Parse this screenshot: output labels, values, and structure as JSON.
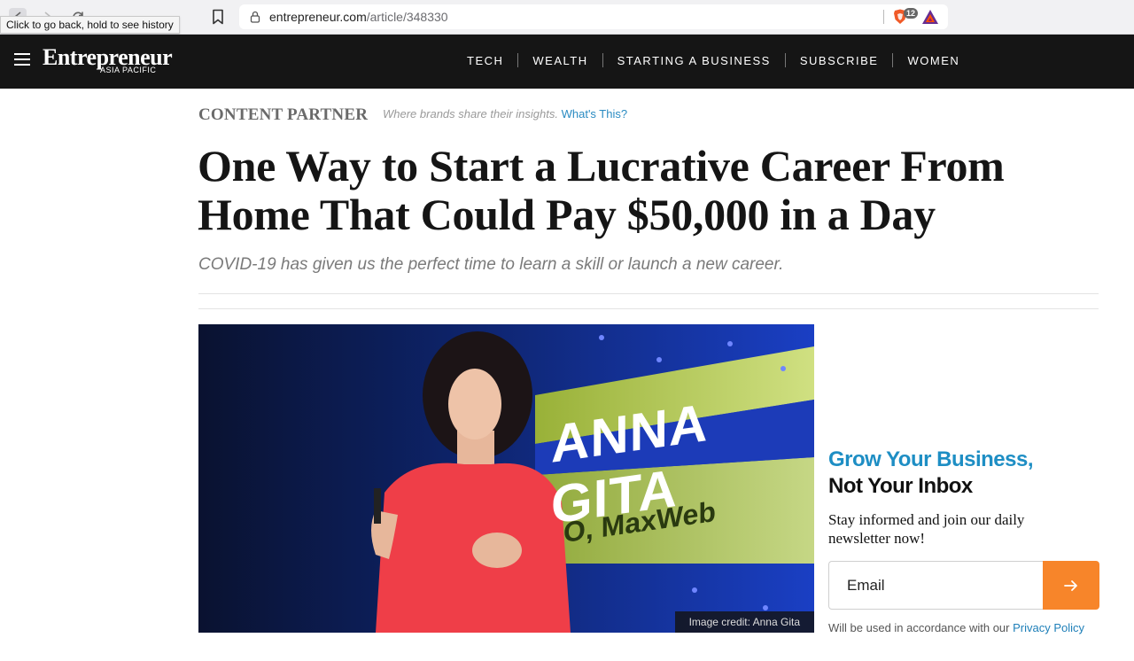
{
  "browser": {
    "tooltip": "Click to go back, hold to see history",
    "url_domain": "entrepreneur.com",
    "url_path": "/article/348330",
    "shield_count": "12"
  },
  "site": {
    "logo": "Entrepreneur",
    "logo_sub": "ASIA PACIFIC",
    "nav": [
      "TECH",
      "WEALTH",
      "STARTING A BUSINESS",
      "SUBSCRIBE",
      "WOMEN"
    ]
  },
  "article": {
    "partner_label": "CONTENT PARTNER",
    "partner_desc": "Where brands share their insights.",
    "partner_link": "What's This?",
    "headline": "One Way to Start a Lucrative Career From Home That Could Pay $50,000 in a Day",
    "dek": "COVID-19 has given us the perfect time to learn a skill or launch a new career.",
    "image_credit": "Image credit: Anna Gita",
    "image_screen_text": "ANNA GITA",
    "image_screen_subtext": "O, MaxWeb"
  },
  "newsletter": {
    "title_line1": "Grow Your Business,",
    "title_line2": "Not Your Inbox",
    "body": "Stay informed and join our daily newsletter now!",
    "email_placeholder": "Email",
    "note": "Will be used in accordance with our ",
    "note_link": "Privacy Policy"
  },
  "colors": {
    "accent_blue": "#1e8ec4",
    "cta_orange": "#f7852a",
    "header_bg": "#151515"
  }
}
